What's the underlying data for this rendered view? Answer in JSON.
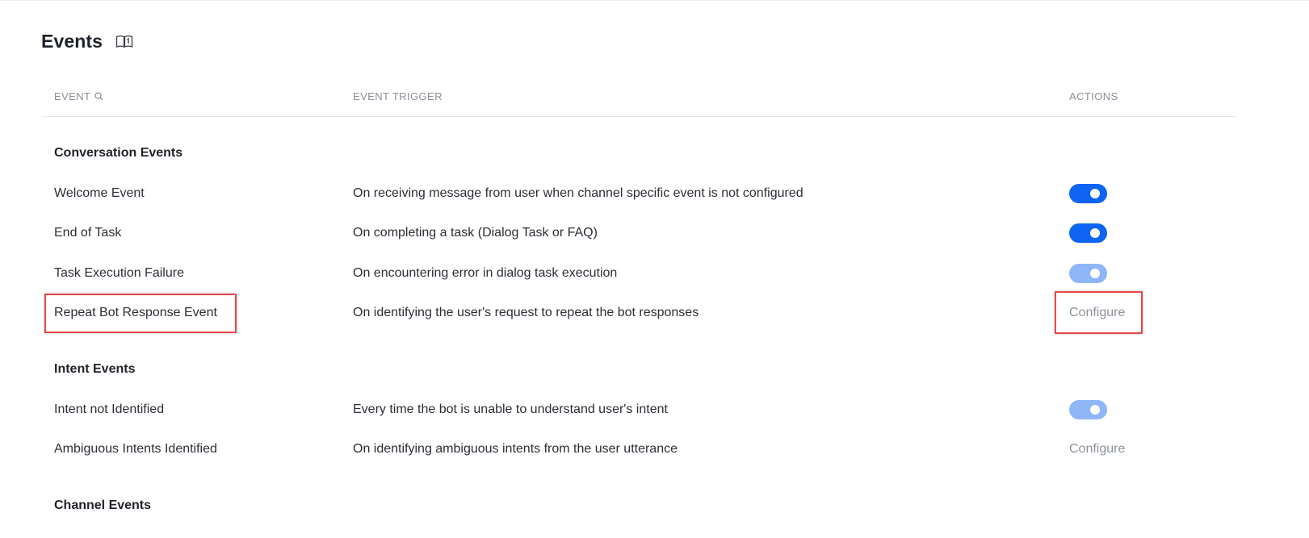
{
  "page": {
    "title": "Events",
    "help_icon": "book-icon"
  },
  "columns": {
    "event": "EVENT",
    "trigger": "EVENT TRIGGER",
    "actions": "ACTIONS",
    "event_search_icon": "search-icon"
  },
  "sections": [
    {
      "title": "Conversation Events",
      "rows": [
        {
          "name": "Welcome Event",
          "trigger": "On receiving message from user when channel specific event is not configured",
          "action": {
            "type": "toggle",
            "on": true,
            "enabled": true
          }
        },
        {
          "name": "End of Task",
          "trigger": "On completing a task (Dialog Task or FAQ)",
          "action": {
            "type": "toggle",
            "on": true,
            "enabled": true
          }
        },
        {
          "name": "Task Execution Failure",
          "trigger": "On encountering error in dialog task execution",
          "action": {
            "type": "toggle",
            "on": true,
            "enabled": false
          }
        },
        {
          "name": "Repeat Bot Response Event",
          "trigger": "On identifying the user's request to repeat the bot responses",
          "action": {
            "type": "link",
            "label": "Configure"
          }
        }
      ]
    },
    {
      "title": "Intent Events",
      "rows": [
        {
          "name": "Intent not Identified",
          "trigger": "Every time the bot is unable to understand user's intent",
          "action": {
            "type": "toggle",
            "on": true,
            "enabled": false
          }
        },
        {
          "name": "Ambiguous Intents Identified",
          "trigger": "On identifying ambiguous intents from the user utterance",
          "action": {
            "type": "link",
            "label": "Configure"
          }
        }
      ]
    },
    {
      "title": "Channel Events",
      "rows": []
    }
  ],
  "colors": {
    "toggle_on": "#0e64f3",
    "toggle_disabled": "#8fb7f8",
    "highlight": "#e8474a"
  }
}
